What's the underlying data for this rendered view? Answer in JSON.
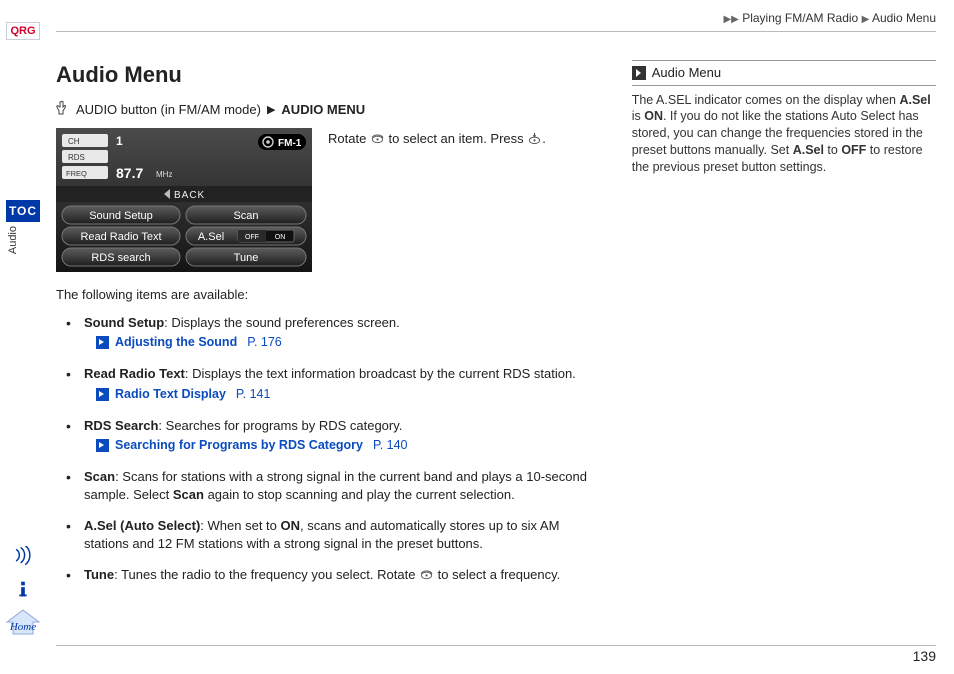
{
  "rail": {
    "qrc": "QRG",
    "toc": "TOC",
    "section": "Audio",
    "home": "Home"
  },
  "breadcrumb": {
    "a": "Playing FM/AM Radio",
    "b": "Audio Menu"
  },
  "page": {
    "number": "139"
  },
  "title": "Audio Menu",
  "pathline": {
    "a": "AUDIO button (in FM/AM mode)",
    "b": "AUDIO MENU"
  },
  "caption": {
    "pre": "Rotate ",
    "mid": " to select an item. Press ",
    "post": "."
  },
  "display": {
    "ch_label": "CH",
    "ch_value": "1",
    "rds_label": "RDS",
    "freq_label": "FREQ",
    "freq_value": "87.7",
    "freq_unit": "MHz",
    "band": "FM-1",
    "back": "BACK",
    "btn_sound": "Sound Setup",
    "btn_scan": "Scan",
    "btn_read": "Read Radio Text",
    "btn_asel": "A.Sel",
    "asel_off": "OFF",
    "asel_on": "ON",
    "btn_rds": "RDS search",
    "btn_tune": "Tune"
  },
  "intro": "The following items are available:",
  "items": {
    "sound": {
      "name": "Sound Setup",
      "desc": ": Displays the sound preferences screen.",
      "xref": "Adjusting the Sound",
      "page": "P. 176"
    },
    "read": {
      "name": "Read Radio Text",
      "desc": ": Displays the text information broadcast by the current RDS station.",
      "xref": "Radio Text Display",
      "page": "P. 141"
    },
    "rds": {
      "name": "RDS Search",
      "desc": ": Searches for programs by RDS category.",
      "xref": "Searching for Programs by RDS Category",
      "page": "P. 140"
    },
    "scan": {
      "name": "Scan",
      "desc_a": ": Scans for stations with a strong signal in the current band and plays a 10-second sample. Select ",
      "again": "Scan",
      "desc_b": " again to stop scanning and play the current selection."
    },
    "asel": {
      "name": "A.Sel (Auto Select)",
      "desc_a": ": When set to ",
      "on": "ON",
      "desc_b": ", scans and automatically stores up to six AM stations and 12 FM stations with a strong signal in the preset buttons."
    },
    "tune": {
      "name": "Tune",
      "desc_a": ": Tunes the radio to the frequency you select. Rotate ",
      "desc_b": " to select a frequency."
    }
  },
  "sidebar": {
    "head": "Audio Menu",
    "body_a": "The A.SEL indicator comes on the display when ",
    "b1": "A.Sel",
    "body_b": " is ",
    "b2": "ON",
    "body_c": ". If you do not like the stations Auto Select has stored, you can change the frequencies stored in the preset buttons manually. Set ",
    "b3": "A.Sel",
    "body_d": " to ",
    "b4": "OFF",
    "body_e": " to restore the previous preset button settings."
  }
}
